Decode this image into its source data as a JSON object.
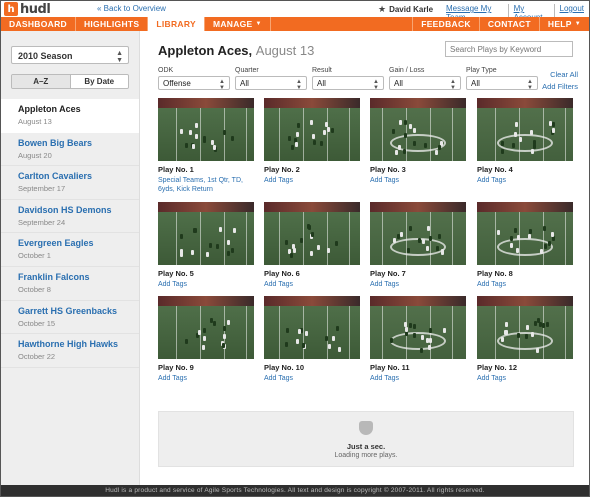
{
  "app": {
    "logo_glyph": "h",
    "logo_text": "hudl",
    "back_link": "« Back to Overview"
  },
  "user": {
    "name": "David Karle",
    "links": [
      "Message My Team",
      "My Account",
      "Logout"
    ]
  },
  "nav": {
    "left": [
      "DASHBOARD",
      "HIGHLIGHTS",
      "LIBRARY",
      "MANAGE"
    ],
    "right": [
      "FEEDBACK",
      "CONTACT",
      "HELP"
    ],
    "active": "LIBRARY"
  },
  "sidebar": {
    "season": "2010 Season",
    "sort": [
      "A–Z",
      "By Date"
    ],
    "games": [
      {
        "name": "Appleton Aces",
        "date": "August 13"
      },
      {
        "name": "Bowen Big Bears",
        "date": "August 20"
      },
      {
        "name": "Carlton Cavaliers",
        "date": "September 17"
      },
      {
        "name": "Davidson HS Demons",
        "date": "September 24"
      },
      {
        "name": "Evergreen Eagles",
        "date": "October 1"
      },
      {
        "name": "Franklin Falcons",
        "date": "October 8"
      },
      {
        "name": "Garrett HS Greenbacks",
        "date": "October 15"
      },
      {
        "name": "Hawthorne High Hawks",
        "date": "October 22"
      }
    ]
  },
  "main": {
    "title": "Appleton Aces,",
    "date": "August 13",
    "search_placeholder": "Search Plays by Keyword",
    "filters": [
      {
        "label": "ODK",
        "value": "Offense"
      },
      {
        "label": "Quarter",
        "value": "All"
      },
      {
        "label": "Result",
        "value": "All"
      },
      {
        "label": "Gain / Loss",
        "value": "All"
      },
      {
        "label": "Play Type",
        "value": "All"
      }
    ],
    "clear_all": "Clear All",
    "add_filters": "Add Filters",
    "plays": [
      {
        "name": "Play No. 1",
        "tags": "Special Teams, 1st Qtr, TD, 6yds, Kick Return"
      },
      {
        "name": "Play No. 2",
        "tags": "Add Tags"
      },
      {
        "name": "Play No. 3",
        "tags": "Add Tags"
      },
      {
        "name": "Play No. 4",
        "tags": "Add Tags"
      },
      {
        "name": "Play No. 5",
        "tags": "Add Tags"
      },
      {
        "name": "Play No. 6",
        "tags": "Add Tags"
      },
      {
        "name": "Play No. 7",
        "tags": "Add Tags"
      },
      {
        "name": "Play No. 8",
        "tags": "Add Tags"
      },
      {
        "name": "Play No. 9",
        "tags": "Add Tags"
      },
      {
        "name": "Play No. 10",
        "tags": "Add Tags"
      },
      {
        "name": "Play No. 11",
        "tags": "Add Tags"
      },
      {
        "name": "Play No. 12",
        "tags": "Add Tags"
      }
    ],
    "loading_title": "Just a sec.",
    "loading_text": "Loading more plays."
  },
  "footer": "Hudl is a product and service of Agile Sports Technologies. All text and design is copyright © 2007-2011. All rights reserved.",
  "colors": {
    "brand": "#f26b21",
    "link": "#2a6fb0"
  }
}
